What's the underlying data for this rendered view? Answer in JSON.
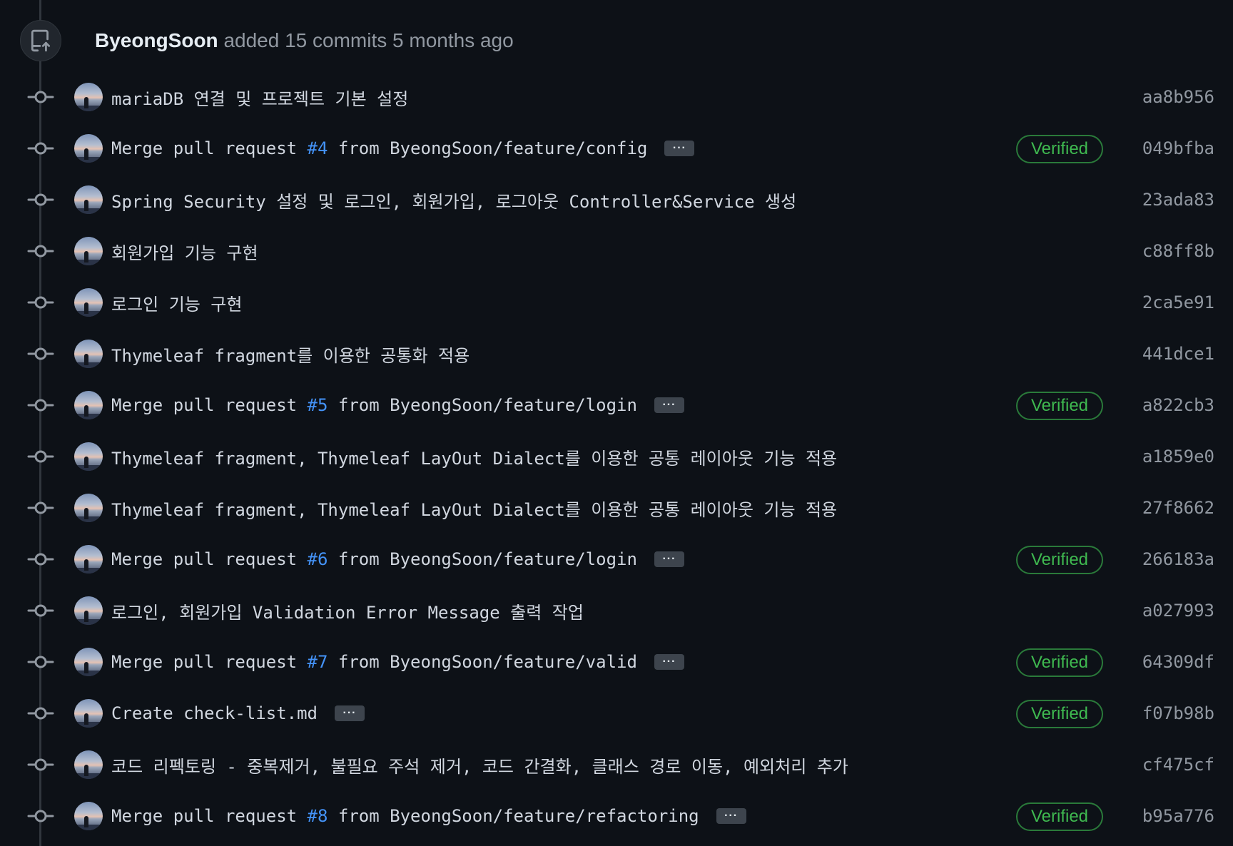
{
  "event": {
    "author": "ByeongSoon",
    "action": "added 15 commits 5 months ago",
    "icon": "repo-push-icon"
  },
  "colors": {
    "background": "#0d1117",
    "link": "#4493f8",
    "verified": "#3fb950",
    "muted": "#9198a1"
  },
  "commits": [
    {
      "pre": "mariaDB 연결 및 프로젝트 기본 설정",
      "pr": "",
      "post": "",
      "ellipsis": false,
      "verified": "",
      "sha": "aa8b956"
    },
    {
      "pre": "Merge pull request ",
      "pr": "#4",
      "post": " from ByeongSoon/feature/config",
      "ellipsis": true,
      "verified": "Verified",
      "sha": "049bfba"
    },
    {
      "pre": "Spring Security 설정 및 로그인, 회원가입, 로그아웃 Controller&Service 생성",
      "pr": "",
      "post": "",
      "ellipsis": false,
      "verified": "",
      "sha": "23ada83"
    },
    {
      "pre": "회원가입 기능 구현",
      "pr": "",
      "post": "",
      "ellipsis": false,
      "verified": "",
      "sha": "c88ff8b"
    },
    {
      "pre": "로그인 기능 구현",
      "pr": "",
      "post": "",
      "ellipsis": false,
      "verified": "",
      "sha": "2ca5e91"
    },
    {
      "pre": "Thymeleaf fragment를 이용한 공통화 적용",
      "pr": "",
      "post": "",
      "ellipsis": false,
      "verified": "",
      "sha": "441dce1"
    },
    {
      "pre": "Merge pull request ",
      "pr": "#5",
      "post": " from ByeongSoon/feature/login",
      "ellipsis": true,
      "verified": "Verified",
      "sha": "a822cb3"
    },
    {
      "pre": "Thymeleaf fragment, Thymeleaf LayOut Dialect를 이용한 공통 레이아웃 기능 적용",
      "pr": "",
      "post": "",
      "ellipsis": false,
      "verified": "",
      "sha": "a1859e0"
    },
    {
      "pre": "Thymeleaf fragment, Thymeleaf LayOut Dialect를 이용한 공통 레이아웃 기능 적용",
      "pr": "",
      "post": "",
      "ellipsis": false,
      "verified": "",
      "sha": "27f8662"
    },
    {
      "pre": "Merge pull request ",
      "pr": "#6",
      "post": " from ByeongSoon/feature/login",
      "ellipsis": true,
      "verified": "Verified",
      "sha": "266183a"
    },
    {
      "pre": "로그인, 회원가입 Validation Error Message 출력 작업",
      "pr": "",
      "post": "",
      "ellipsis": false,
      "verified": "",
      "sha": "a027993"
    },
    {
      "pre": "Merge pull request ",
      "pr": "#7",
      "post": " from ByeongSoon/feature/valid",
      "ellipsis": true,
      "verified": "Verified",
      "sha": "64309df"
    },
    {
      "pre": "Create check-list.md",
      "pr": "",
      "post": "",
      "ellipsis": true,
      "verified": "Verified",
      "sha": "f07b98b"
    },
    {
      "pre": "코드 리펙토링 - 중복제거, 불필요 주석 제거, 코드 간결화, 클래스 경로 이동, 예외처리 추가",
      "pr": "",
      "post": "",
      "ellipsis": false,
      "verified": "",
      "sha": "cf475cf"
    },
    {
      "pre": "Merge pull request ",
      "pr": "#8",
      "post": " from ByeongSoon/feature/refactoring",
      "ellipsis": true,
      "verified": "Verified",
      "sha": "b95a776"
    }
  ]
}
